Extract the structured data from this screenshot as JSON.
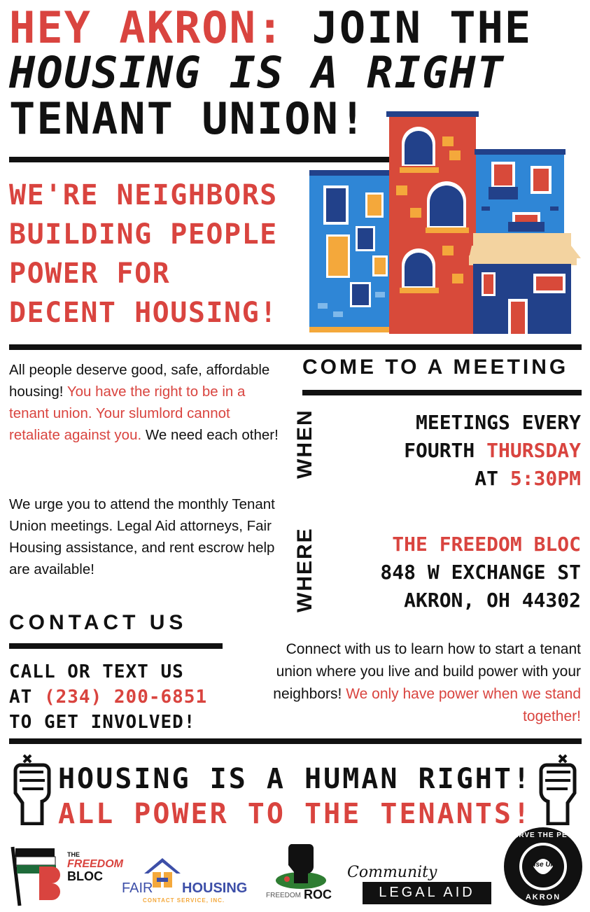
{
  "headline": {
    "line1_red": "HEY AKRON:",
    "line1_black": " JOIN THE",
    "line2": "HOUSING IS A RIGHT",
    "line3": "TENANT UNION!"
  },
  "subhead": {
    "line1": "WE'RE NEIGHBORS",
    "line2": "BUILDING PEOPLE",
    "line3": "POWER FOR",
    "line4": "DECENT HOUSING!"
  },
  "intro": {
    "p1_a": "All people deserve good, safe, affordable housing! ",
    "p1_red": "You have the right to be in a tenant union. Your slumlord cannot retaliate against you.",
    "p1_b": " We need each other!",
    "p2": "We urge you to attend the monthly Tenant Union meetings. Legal Aid attorneys, Fair Housing assistance, and rent escrow help are available!"
  },
  "meeting": {
    "heading": "COME TO A MEETING",
    "when_label": "WHEN",
    "when_line1": "MEETINGS EVERY",
    "when_line2_a": "FOURTH ",
    "when_line2_red": "THURSDAY",
    "when_line3_a": "AT ",
    "when_line3_red": "5:30PM",
    "where_label": "WHERE",
    "where_line1": "THE FREEDOM BLOC",
    "where_line2": "848 W EXCHANGE ST",
    "where_line3": "AKRON, OH 44302"
  },
  "contact": {
    "heading": "CONTACT US",
    "line1": "CALL OR TEXT US",
    "line2_a": "AT ",
    "line2_red": "(234) 200-6851",
    "line3": "TO GET  INVOLVED!"
  },
  "connect": {
    "text": "Connect with us to learn how to start a tenant union where you live and build power with your neighbors! ",
    "text_red": "We only have power when we stand together!"
  },
  "footer": {
    "line1": "HOUSING IS A HUMAN RIGHT!",
    "line2": "ALL POWER TO THE TENANTS!"
  },
  "logos": {
    "freedom_bloc_the": "THE",
    "freedom_bloc_name": "FREEDOM",
    "freedom_bloc_bloc": "BLOC",
    "fair_housing_fair": "FAIR",
    "fair_housing_housing": "HOUSING",
    "fair_housing_sub": "CONTACT SERVICE, INC.",
    "freedom_roc_a": "FREEDOM",
    "freedom_roc_b": "ROC",
    "community_legal_script": "Community",
    "community_legal_box": "LEGAL AID",
    "serve_people_top": "SERVE THE PEOPLE",
    "serve_people_bottom": "AKRON",
    "serve_people_center": "Rise UP!"
  },
  "colors": {
    "accent_red": "#d9443f",
    "black": "#111111",
    "building_blue": "#2f86d6",
    "building_red": "#d84a3a",
    "building_navy": "#22418a",
    "window_orange": "#f4a83b"
  }
}
